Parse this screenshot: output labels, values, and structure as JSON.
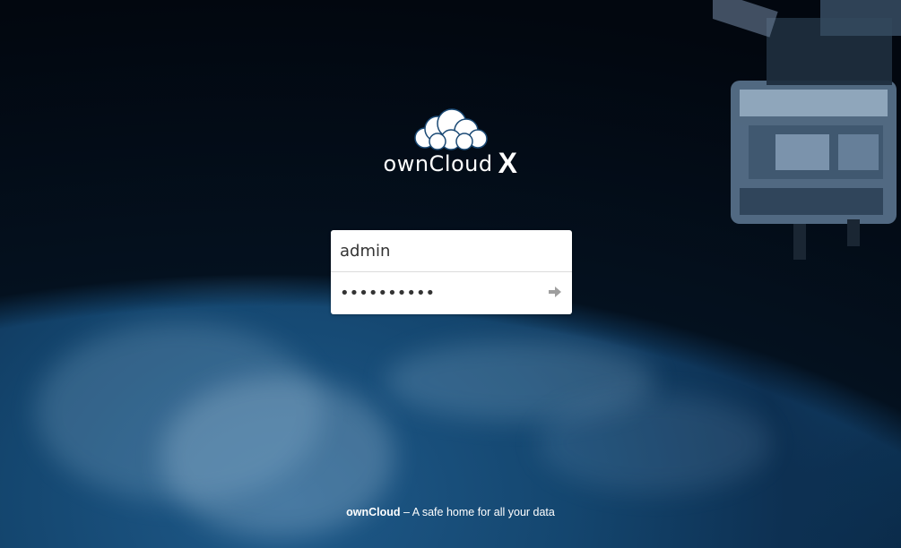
{
  "header": {
    "logo_text": "ownCloud",
    "logo_suffix": "X"
  },
  "login": {
    "username_value": "admin",
    "password_value": "••••••••••"
  },
  "footer": {
    "brand": "ownCloud",
    "slogan": " – A safe home for all your data"
  },
  "icons": {
    "logo": "cloud-icon",
    "submit": "arrow-right-icon"
  },
  "colors": {
    "background": "#14466f",
    "text": "#ffffff",
    "submit_arrow": "#9e9e9e"
  }
}
